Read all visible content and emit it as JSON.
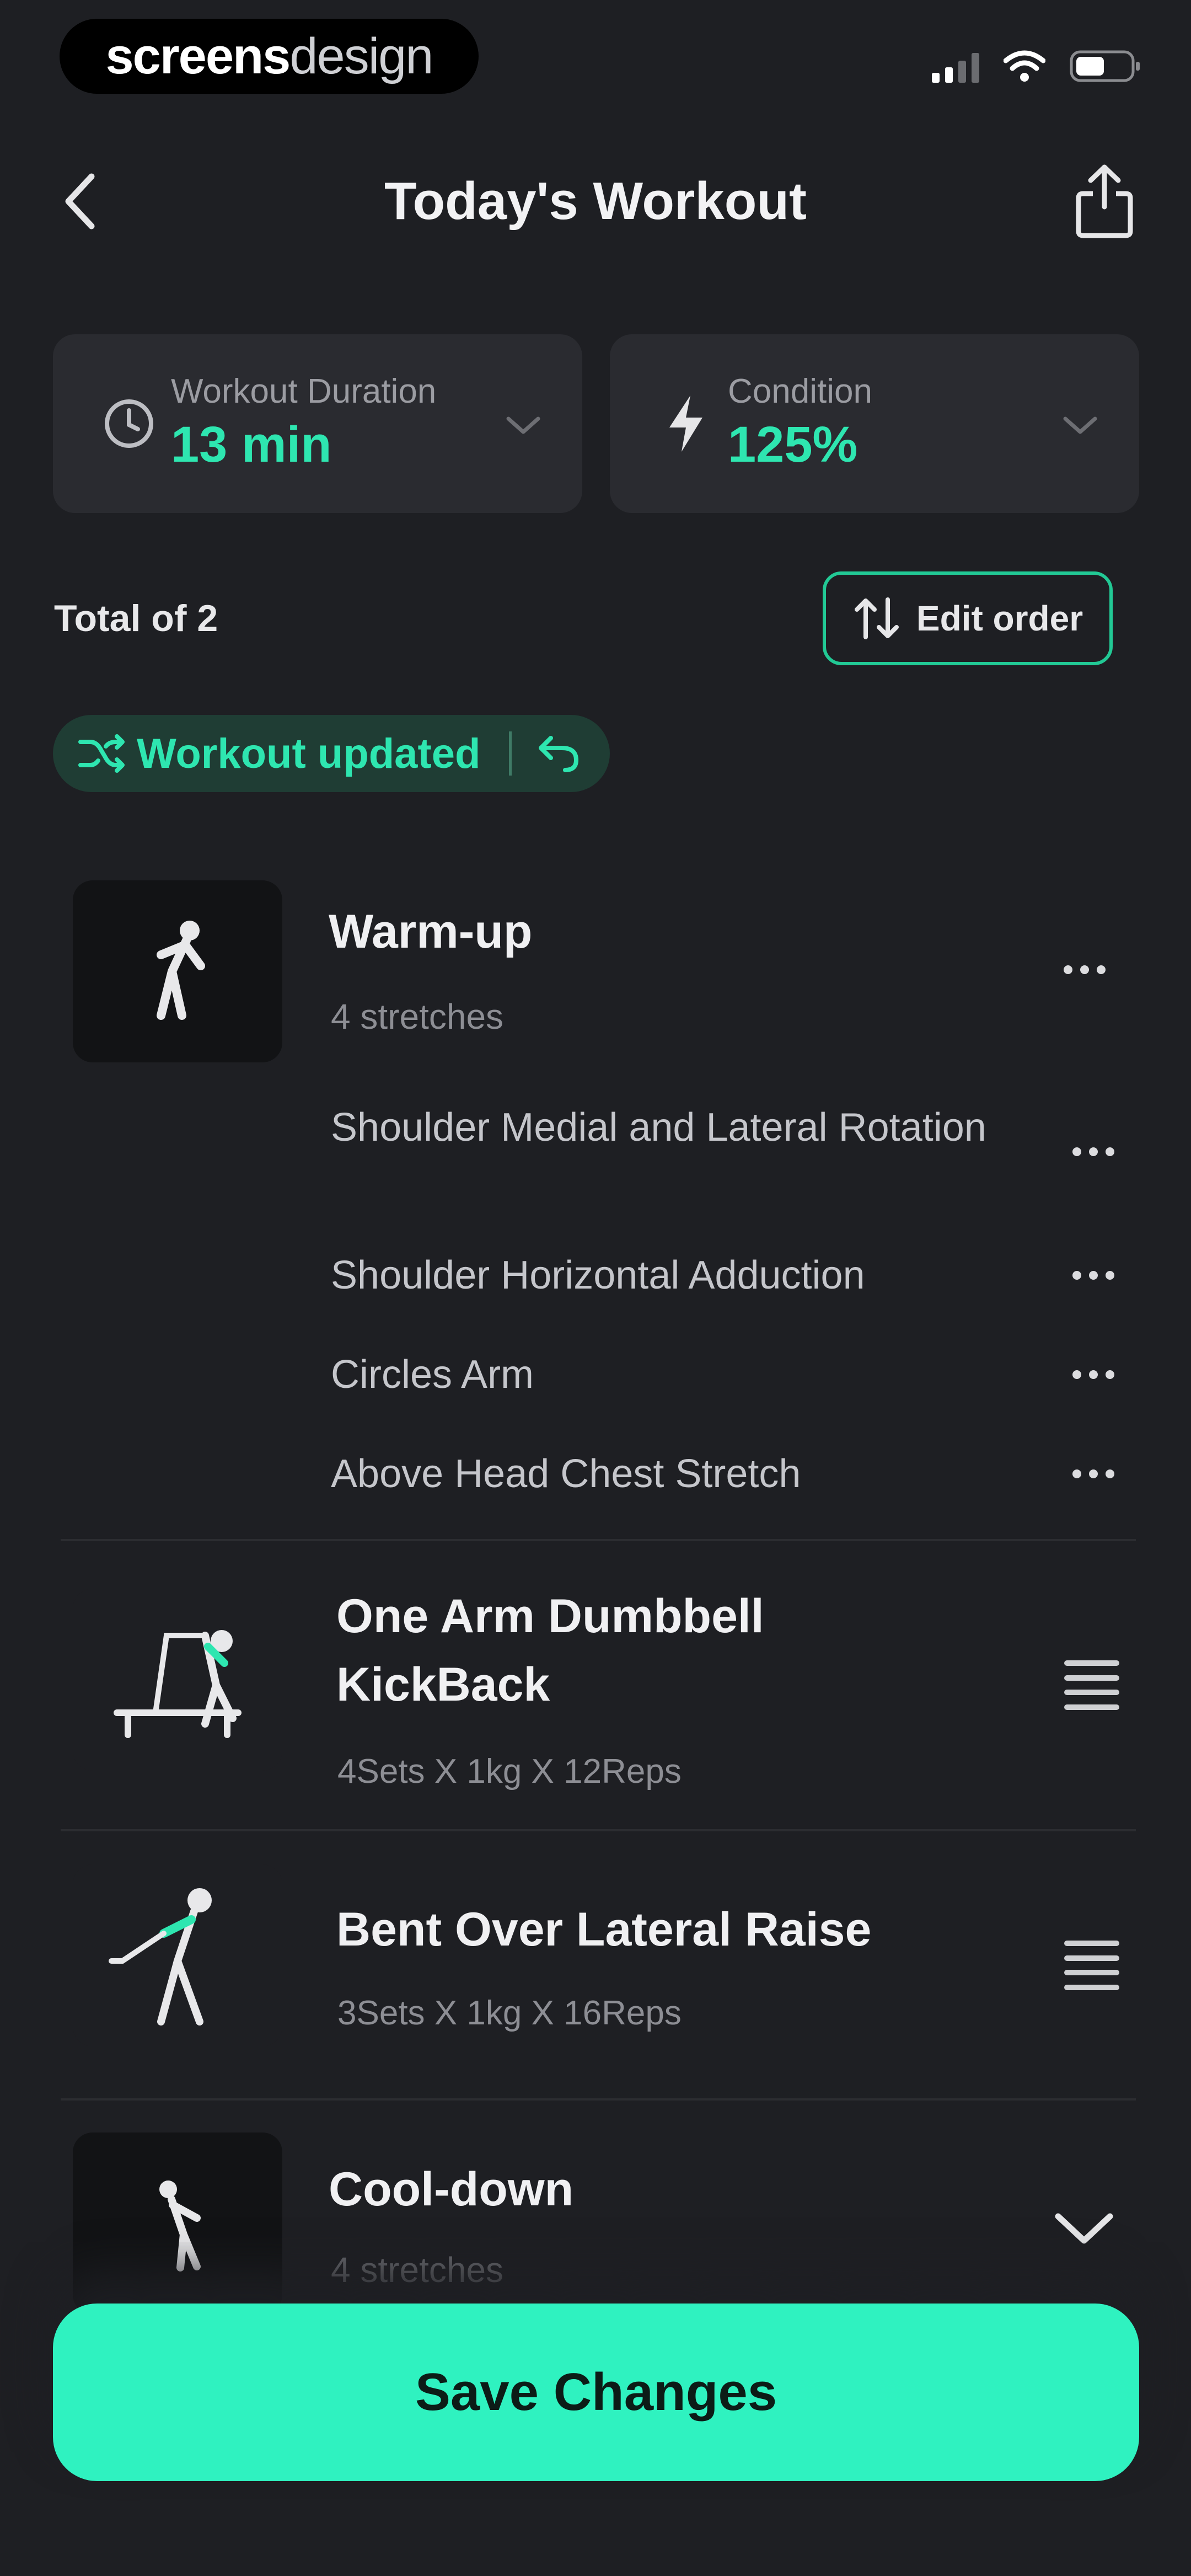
{
  "status_bar": {
    "brand_bold": "screens",
    "brand_light": "design"
  },
  "header": {
    "title": "Today's Workout"
  },
  "metrics": {
    "duration_label": "Workout Duration",
    "duration_value": "13 min",
    "condition_label": "Condition",
    "condition_value": "125%"
  },
  "summary": {
    "total": "Total of 2",
    "edit_order": "Edit order",
    "updated": "Workout updated"
  },
  "warmup": {
    "title": "Warm-up",
    "subtitle": "4 stretches",
    "items": [
      "Shoulder Medial and Lateral Rotation",
      "Shoulder Horizontal Adduction",
      "Circles Arm",
      "Above Head Chest Stretch"
    ]
  },
  "exercises": [
    {
      "title": "One Arm Dumbbell KickBack",
      "detail": "4Sets X 1kg X 12Reps"
    },
    {
      "title": "Bent Over Lateral Raise",
      "detail": "3Sets X 1kg X 16Reps"
    }
  ],
  "cooldown": {
    "title": "Cool-down",
    "subtitle": "4 stretches"
  },
  "footer": {
    "save": "Save Changes"
  },
  "colors": {
    "accent": "#2ee6b0",
    "background": "#1e1f23",
    "card": "#2a2b30"
  },
  "icons": [
    "back-icon",
    "share-icon",
    "clock-icon",
    "bolt-icon",
    "chevron-down-icon",
    "sort-icon",
    "shuffle-icon",
    "undo-icon",
    "more-icon",
    "drag-handle-icon"
  ]
}
